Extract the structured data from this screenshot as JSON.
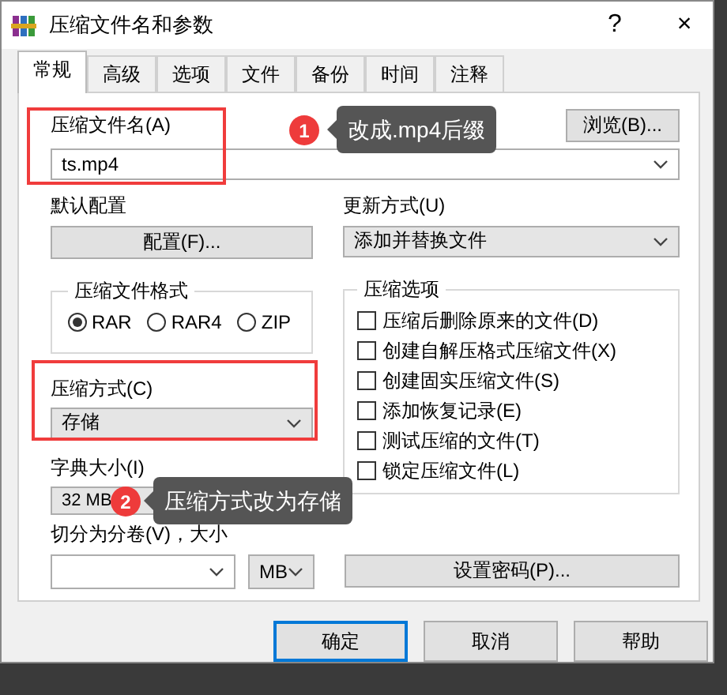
{
  "window": {
    "title": "压缩文件名和参数",
    "help": "?",
    "close": "×"
  },
  "tabs": [
    {
      "label": "常规",
      "selected": true
    },
    {
      "label": "高级",
      "selected": false
    },
    {
      "label": "选项",
      "selected": false
    },
    {
      "label": "文件",
      "selected": false
    },
    {
      "label": "备份",
      "selected": false
    },
    {
      "label": "时间",
      "selected": false
    },
    {
      "label": "注释",
      "selected": false
    }
  ],
  "archive_name": {
    "label": "压缩文件名(A)",
    "value": "ts.mp4",
    "browse_button": "浏览(B)..."
  },
  "profile": {
    "label": "默认配置",
    "button": "配置(F)..."
  },
  "update_mode": {
    "label": "更新方式(U)",
    "value": "添加并替换文件"
  },
  "format": {
    "title": "压缩文件格式",
    "options": [
      {
        "label": "RAR",
        "selected": true
      },
      {
        "label": "RAR4",
        "selected": false
      },
      {
        "label": "ZIP",
        "selected": false
      }
    ]
  },
  "compression_method": {
    "label": "压缩方式(C)",
    "value": "存储"
  },
  "dictionary_size": {
    "label": "字典大小(I)",
    "value": "32 MB"
  },
  "split": {
    "label": "切分为分卷(V)，大小",
    "unit": "MB"
  },
  "options": {
    "title": "压缩选项",
    "items": [
      {
        "label": "压缩后删除原来的文件(D)",
        "checked": false
      },
      {
        "label": "创建自解压格式压缩文件(X)",
        "checked": false
      },
      {
        "label": "创建固实压缩文件(S)",
        "checked": false
      },
      {
        "label": "添加恢复记录(E)",
        "checked": false
      },
      {
        "label": "测试压缩的文件(T)",
        "checked": false
      },
      {
        "label": "锁定压缩文件(L)",
        "checked": false
      }
    ]
  },
  "password_button": "设置密码(P)...",
  "buttons": [
    {
      "label": "确定",
      "focused": true
    },
    {
      "label": "取消",
      "focused": false
    },
    {
      "label": "帮助",
      "focused": false
    }
  ],
  "annotations": [
    {
      "number": "1",
      "text": "改成.mp4后缀"
    },
    {
      "number": "2",
      "text": "压缩方式改为存储"
    }
  ]
}
